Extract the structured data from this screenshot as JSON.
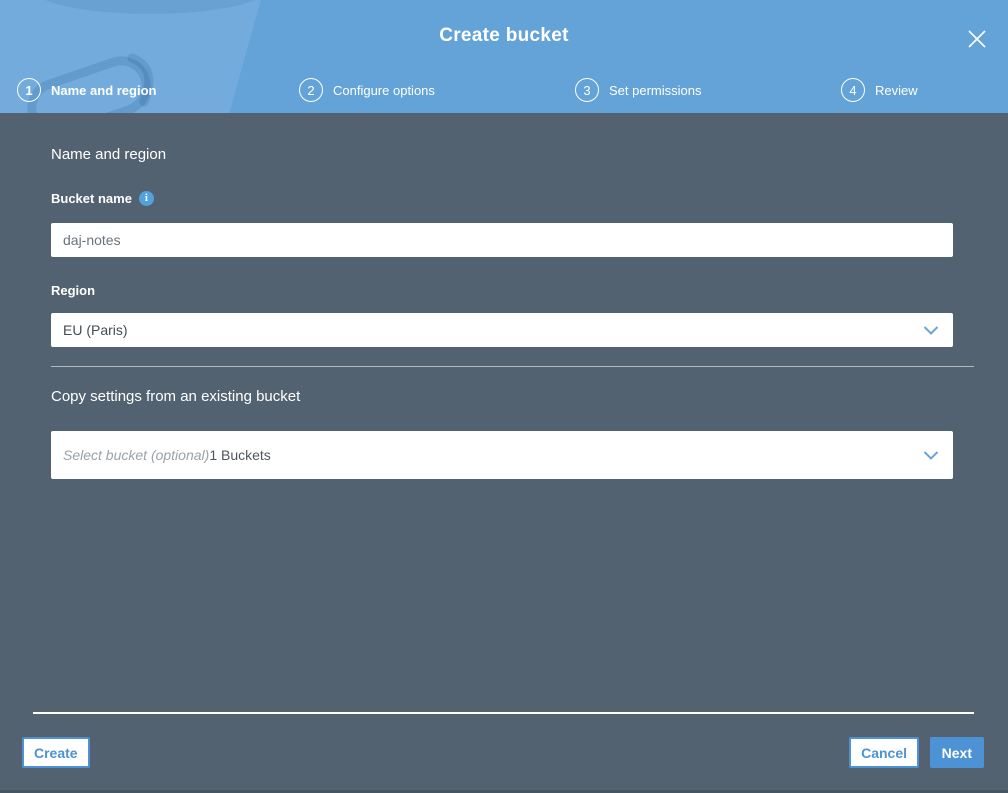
{
  "header": {
    "title": "Create bucket",
    "steps": [
      {
        "number": "1",
        "label": "Name and region"
      },
      {
        "number": "2",
        "label": "Configure options"
      },
      {
        "number": "3",
        "label": "Set permissions"
      },
      {
        "number": "4",
        "label": "Review"
      }
    ]
  },
  "form": {
    "section_heading": "Name and region",
    "bucket_name": {
      "label": "Bucket name",
      "value": "daj-notes",
      "info_icon": "i"
    },
    "region": {
      "label": "Region",
      "value": "EU (Paris)"
    },
    "copy_settings": {
      "heading": "Copy settings from an existing bucket",
      "placeholder": "Select bucket (optional)",
      "count_text": "1 Buckets"
    }
  },
  "footer": {
    "create": "Create",
    "cancel": "Cancel",
    "next": "Next"
  },
  "colors": {
    "header_blue": "#64a3d8",
    "body_slate": "#536270",
    "accent_blue": "#4c92d4"
  }
}
